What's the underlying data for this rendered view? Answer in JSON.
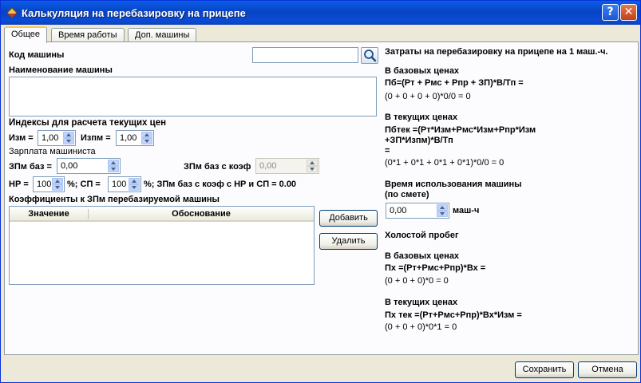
{
  "window": {
    "title": "Калькуляция на перебазировку на прицепе",
    "help_glyph": "?",
    "close_glyph": "✕"
  },
  "tabs": [
    {
      "label": "Общее",
      "active": true
    },
    {
      "label": "Время работы",
      "active": false
    },
    {
      "label": "Доп. машины",
      "active": false
    }
  ],
  "left": {
    "machine_code_label": "Код машины",
    "machine_code_value": "",
    "machine_name_label": "Наименование машины",
    "machine_name_value": "",
    "indices_title": "Индексы для расчета текущих цен",
    "izm_label": "Изм =",
    "izm_value": "1,00",
    "izpm_label": "Изпм =",
    "izpm_value": "1,00",
    "salary_title": "Зарплата машиниста",
    "zpm_base_label": "ЗПм баз =",
    "zpm_base_value": "0,00",
    "zpm_coef_label": "ЗПм баз с коэф",
    "zpm_coef_value": "0,00",
    "hr_label": "НР =",
    "hr_value": "100",
    "sp_label": "%; СП =",
    "sp_value": "100",
    "zpm_hr_sp_text": "%; ЗПм баз с коэф с НР и СП = 0.00",
    "coef_title": "Коэффициенты к ЗПм перебазируемой машины",
    "grid_columns": [
      "Значение",
      "Обоснование"
    ],
    "grid_rows": [],
    "add_button": "Добавить",
    "delete_button": "Удалить"
  },
  "right": {
    "heading": "Затраты на перебазировку на прицепе на 1 маш.-ч.",
    "base_prices_1": "В базовых ценах",
    "pb_formula": "Пб=(Рт + Рмс + Рпр + ЗП)*В/Тп =",
    "pb_result": "(0 + 0 + 0 + 0)*0/0 = 0",
    "current_prices_1": "В текущих ценах",
    "pbtek_formula_1": "Пбтек =(Рт*Изм+Рмс*Изм+Рпр*Изм",
    "pbtek_formula_2": "+ЗП*Изпм)*В/Тп",
    "pbtek_formula_3": "=",
    "pbtek_result": "(0*1 + 0*1 + 0*1 + 0*1)*0/0 = 0",
    "usage_time_1": "Время использования машины",
    "usage_time_2": "(по смете)",
    "usage_value": "0,00",
    "usage_unit": "маш-ч",
    "idle_run": "Холостой пробег",
    "base_prices_2": "В базовых ценах",
    "px_formula": "Пх =(Рт+Рмс+Рпр)*Вх =",
    "px_result": "(0 + 0 + 0)*0 = 0",
    "current_prices_2": "В текущих ценах",
    "pxtek_formula": "Пх тек =(Рт+Рмс+Рпр)*Вх*Изм =",
    "pxtek_result": "(0 + 0 + 0)*0*1 = 0"
  },
  "footer": {
    "save_button": "Сохранить",
    "cancel_button": "Отмена"
  }
}
